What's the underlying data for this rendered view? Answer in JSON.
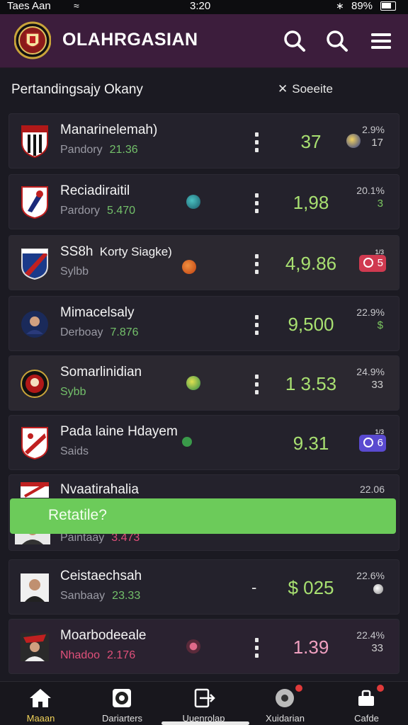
{
  "status_bar": {
    "carrier": "Taes Aan",
    "time": "3:20",
    "battery": "89%"
  },
  "header": {
    "title": "OLAHRGASIAN",
    "icons": [
      "search-icon",
      "search-icon",
      "menu-icon"
    ]
  },
  "subheader": {
    "title": "Pertandingsajy Okany",
    "close_label": "Soeeite"
  },
  "matches": [
    {
      "team": "Manarinelemah)",
      "league": "Pandory",
      "league_value": "21.36",
      "odds": "37",
      "pct": "2.9%",
      "pct_sub": "17",
      "dot_color": "#c9a43a"
    },
    {
      "team": "Reciadiraitil",
      "league": "Pardory",
      "league_value": "5.470",
      "odds": "1,98",
      "pct": "20.1%",
      "pct_sub": "3",
      "dot_color": "#2c8a8a"
    },
    {
      "team": "SS8h",
      "team_extra": "Korty Siagke)",
      "league": "Sylbb",
      "odds": "4,9.86",
      "badge_top": "1/3",
      "badge_num": "5",
      "dot_color": "#e06a2a"
    },
    {
      "team": "Mimacelsaly",
      "league": "Derboay",
      "league_value": "7.876",
      "odds": "9,500",
      "pct": "22.9%",
      "pct_sub": "$"
    },
    {
      "team": "Somarlinidian",
      "league": "Sybb",
      "odds": "1 3.53",
      "pct": "24.9%",
      "pct_sub": "33",
      "dot_color": "#8cc040"
    },
    {
      "team": "Pada laine Hdayem",
      "league": "Saids",
      "odds": "9.31",
      "badge_top": "1/3",
      "badge_num": "6",
      "dot_color": "#3a9a4a"
    },
    {
      "team": "Nvaatirahalia",
      "league": "Paintaay",
      "league_value": "3.473",
      "pct": "22.06"
    },
    {
      "team": "Ceistaechsah",
      "league": "Sanbaay",
      "league_value": "23.33",
      "odds_prefix": "-",
      "odds": "$ 025",
      "pct": "22.6%"
    },
    {
      "team": "Moarbodeeale",
      "league": "Nhadoo",
      "league_value": "2.176",
      "odds": "1.39",
      "pct": "22.4%",
      "pct_sub": "33",
      "dot_color": "#e06a8a"
    }
  ],
  "toast": {
    "label": "Retatile?"
  },
  "bottom_nav": [
    {
      "label": "Maaan",
      "icon": "home-icon",
      "active": true
    },
    {
      "label": "Dariarters",
      "icon": "soccer-ball-icon"
    },
    {
      "label": "Uuenrolap",
      "icon": "export-icon"
    },
    {
      "label": "Xuidarian",
      "icon": "ball-icon"
    },
    {
      "label": "Cafde",
      "icon": "bag-icon"
    }
  ],
  "colors": {
    "header_bg": "#3c1d3c",
    "odds_green": "#a8e071",
    "toast_green": "#6ccb5a",
    "active_nav": "#f2d35a"
  }
}
